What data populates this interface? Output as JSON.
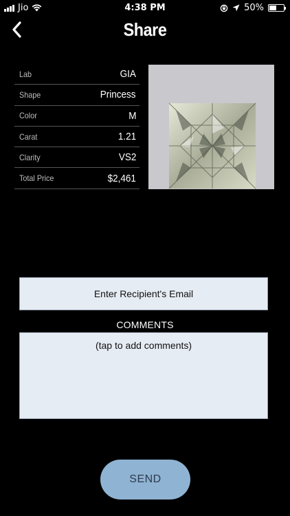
{
  "status_bar": {
    "carrier": "Jio",
    "time": "4:38 PM",
    "battery": "50%",
    "battery_level": 0.5
  },
  "nav": {
    "title": "Share"
  },
  "specs": [
    {
      "label": "Lab",
      "value": "GIA"
    },
    {
      "label": "Shape",
      "value": "Princess"
    },
    {
      "label": "Color",
      "value": "M"
    },
    {
      "label": "Carat",
      "value": "1.21"
    },
    {
      "label": "Clarity",
      "value": "VS2"
    },
    {
      "label": "Total Price",
      "value": "$2,461"
    }
  ],
  "form": {
    "email_placeholder": "Enter Recipient's Email",
    "comments_label": "COMMENTS",
    "comments_placeholder": "(tap to add comments)",
    "send_label": "SEND"
  },
  "colors": {
    "background": "#000000",
    "input_bg": "#e6ecf3",
    "send_button": "#8fb3d3"
  }
}
